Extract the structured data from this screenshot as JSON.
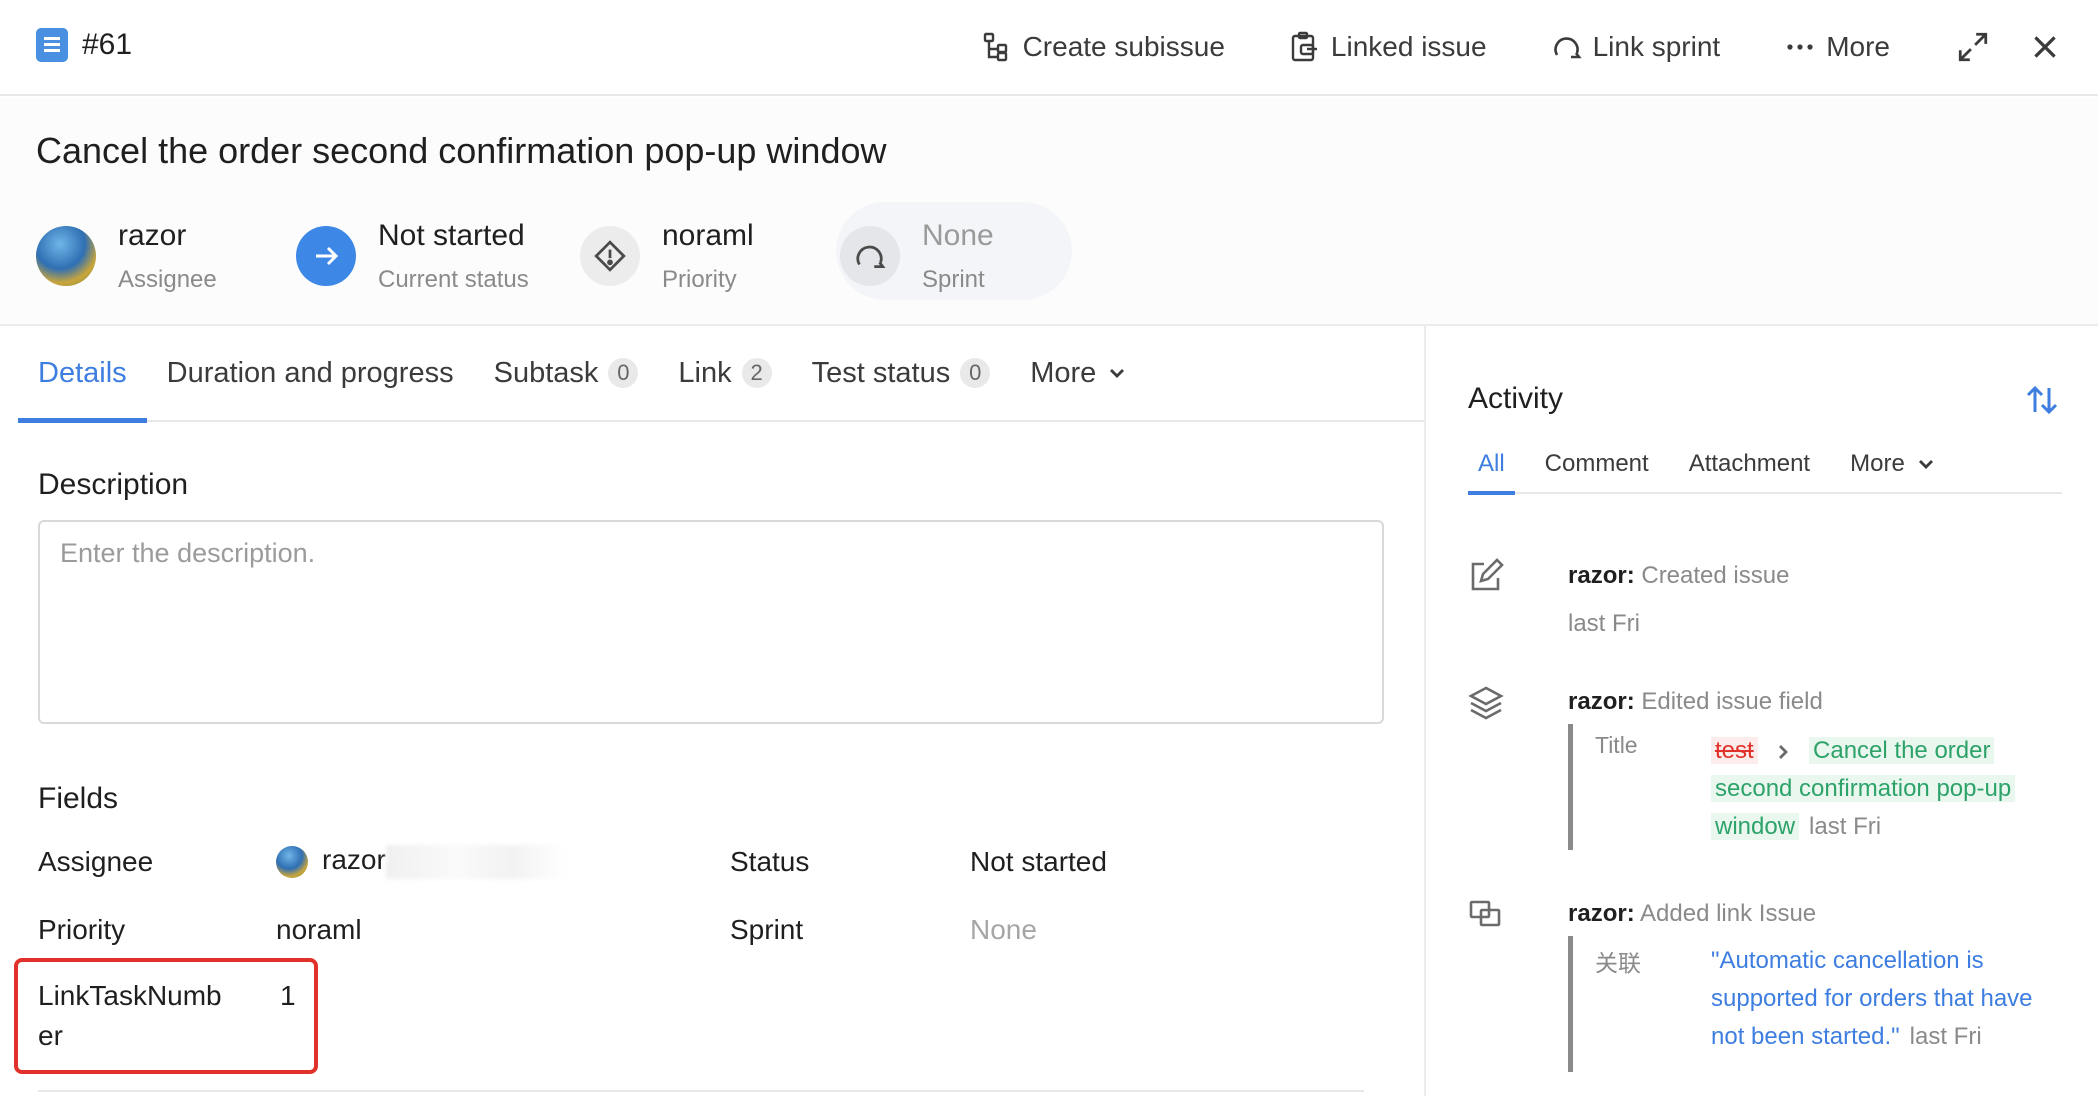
{
  "header": {
    "issue_id": "#61",
    "toolbar": {
      "create_subissue": "Create subissue",
      "linked_issue": "Linked issue",
      "link_sprint": "Link sprint",
      "more": "More"
    }
  },
  "issue": {
    "title": "Cancel the order second confirmation pop-up window",
    "assignee": {
      "value": "razor",
      "label": "Assignee"
    },
    "status": {
      "value": "Not started",
      "label": "Current status"
    },
    "priority": {
      "value": "noraml",
      "label": "Priority"
    },
    "sprint": {
      "value": "None",
      "label": "Sprint"
    }
  },
  "tabs": [
    {
      "label": "Details",
      "count": ""
    },
    {
      "label": "Duration and progress",
      "count": ""
    },
    {
      "label": "Subtask",
      "count": "0"
    },
    {
      "label": "Link",
      "count": "2"
    },
    {
      "label": "Test status",
      "count": "0"
    },
    {
      "label": "More",
      "count": ""
    }
  ],
  "details": {
    "description_title": "Description",
    "description_placeholder": "Enter the description.",
    "fields_title": "Fields",
    "fields": {
      "assignee_label": "Assignee",
      "assignee_value": "razor",
      "status_label": "Status",
      "status_value": "Not started",
      "priority_label": "Priority",
      "priority_value": "noraml",
      "sprint_label": "Sprint",
      "sprint_value": "None",
      "link_task_label_1": "LinkTaskNumb",
      "link_task_label_2": "er",
      "link_task_value": "1"
    }
  },
  "activity": {
    "title": "Activity",
    "tabs": [
      "All",
      "Comment",
      "Attachment",
      "More"
    ],
    "items": [
      {
        "user": "razor:",
        "action": "Created issue",
        "time": "last Fri"
      },
      {
        "user": "razor:",
        "action": "Edited issue field",
        "detail_label": "Title",
        "old_value": "test",
        "new_value_1": "Cancel the order",
        "new_value_2": "second confirmation pop-up",
        "new_value_3": "window",
        "time": "last Fri"
      },
      {
        "user": "razor:",
        "action": "Added link Issue",
        "detail_label": "关联",
        "link_1": "\"Automatic cancellation is",
        "link_2": "supported for orders that have",
        "link_3": "not been started.\"",
        "time": "last Fri"
      }
    ]
  },
  "colors": {
    "accent": "#3d7ee0",
    "highlight_border": "#e0322a",
    "added_green": "#2da36a",
    "removed_red": "#e0322a"
  },
  "icons": [
    "document-icon",
    "subissue-icon",
    "linked-issue-icon",
    "sprint-icon",
    "more-dots-icon",
    "expand-icon",
    "close-icon",
    "arrow-right-icon",
    "priority-diamond-icon",
    "sort-icon",
    "edit-icon",
    "layers-icon",
    "link-icon",
    "chevron-down-icon"
  ]
}
